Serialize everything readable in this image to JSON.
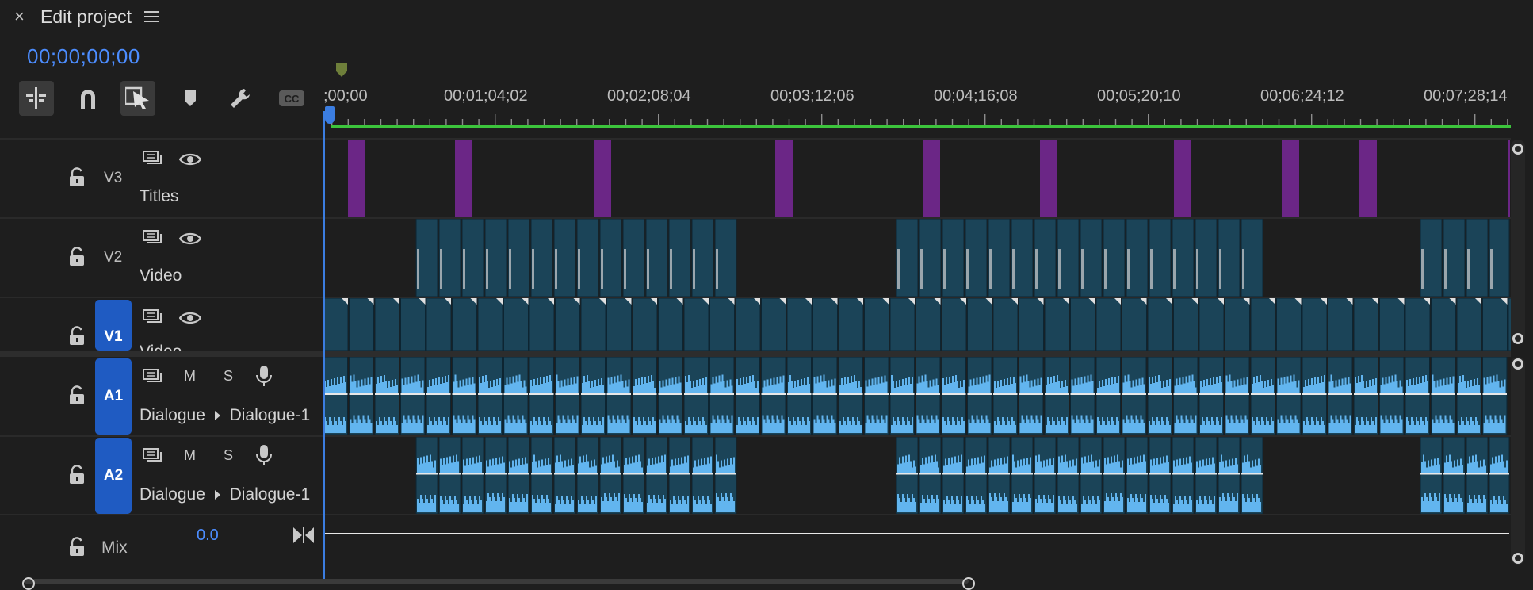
{
  "panel": {
    "close_symbol": "×",
    "title": "Edit project",
    "menu_icon": "hamburger-icon"
  },
  "timecode": "00;00;00;00",
  "toolbar": {
    "tools": [
      "insert-overwrite-icon",
      "snap-magnet-icon",
      "linked-selection-icon",
      "add-marker-icon",
      "wrench-icon",
      "closed-captions-icon"
    ]
  },
  "ruler": {
    "labels": [
      ";00;00",
      "00;01;04;02",
      "00;02;08;04",
      "00;03;12;06",
      "00;04;16;08",
      "00;05;20;10",
      "00;06;24;12",
      "00;07;28;14"
    ]
  },
  "colors": {
    "playhead": "#3b7de0",
    "work_area": "#3cc43c",
    "titles_clip": "#6b2686",
    "video_clip": "#1b4458",
    "audio_wave": "#62b5ef",
    "track_target": "#1f5bc2",
    "timecode": "#4c8dff"
  },
  "tracks": {
    "v3": {
      "label": "V3",
      "name": "Titles"
    },
    "v2": {
      "label": "V2",
      "name": "Video"
    },
    "v1": {
      "label": "V1",
      "name": "Video"
    },
    "a1": {
      "label": "A1",
      "name": "Dialogue",
      "sub": "Dialogue-1",
      "m": "M",
      "s": "S"
    },
    "a2": {
      "label": "A2",
      "name": "Dialogue",
      "sub": "Dialogue-1",
      "m": "M",
      "s": "S"
    },
    "mix": {
      "label": "Mix",
      "value": "0.0"
    }
  }
}
